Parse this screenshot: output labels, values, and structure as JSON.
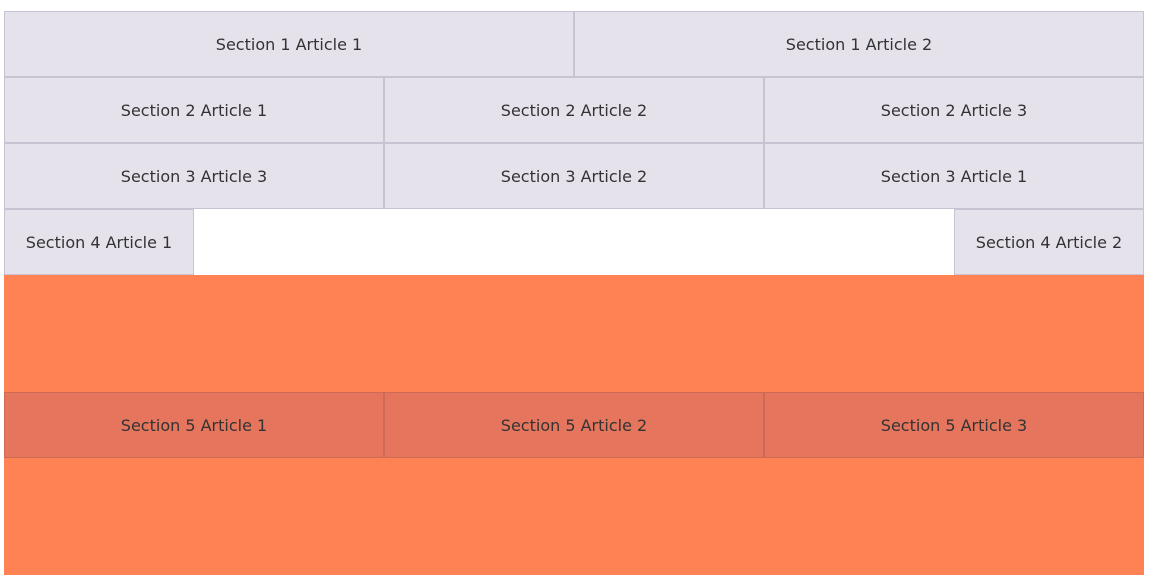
{
  "sections": [
    {
      "articles": [
        "Section 1 Article 1",
        "Section 1 Article 2"
      ]
    },
    {
      "articles": [
        "Section 2 Article 1",
        "Section 2 Article 2",
        "Section 2 Article 3"
      ]
    },
    {
      "articles": [
        "Section 3 Article 3",
        "Section 3 Article 2",
        "Section 3 Article 1"
      ]
    },
    {
      "articles": [
        "Section 4 Article 1",
        "Section 4 Article 2"
      ]
    },
    {
      "articles": [
        "Section 5 Article 1",
        "Section 5 Article 2",
        "Section 5 Article 3"
      ]
    }
  ],
  "colors": {
    "article_background": "#e5e2ec",
    "article_border": "#c7c3d3",
    "section5_background": "#ff8255",
    "section5_article_background": "#e5755d"
  }
}
